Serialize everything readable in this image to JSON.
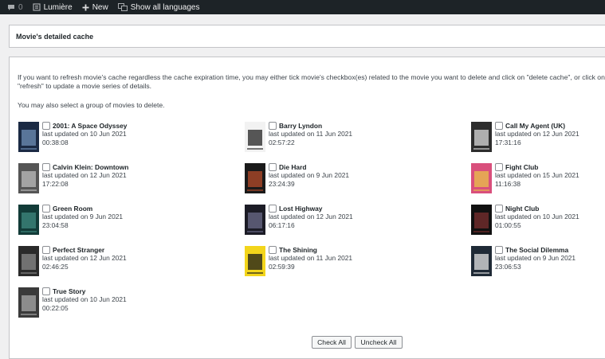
{
  "admin_bar": {
    "comments_count": "0",
    "site_name": "Lumière",
    "new_label": "New",
    "languages_label": "Show all languages"
  },
  "title_panel": {
    "title": "Movie's detailed cache"
  },
  "body": {
    "intro": "If you want to refresh movie's cache regardless the cache expiration time, you may either tick movie's checkbox(es) related to the movie you want to delete and click on \"delete cache\", or click on \"refresh\" to update a movie series of details.",
    "group_note": "You may also select a group of movies to delete."
  },
  "movies": [
    {
      "title": "2001: A Space Odyssey",
      "updated": "last updated on 10 Jun 2021",
      "time": "00:38:08",
      "poster_colors": [
        "#1b2a44",
        "#6f8fb5"
      ]
    },
    {
      "title": "Barry Lyndon",
      "updated": "last updated on 11 Jun 2021",
      "time": "02:57:22",
      "poster_colors": [
        "#f2f2f2",
        "#222222"
      ]
    },
    {
      "title": "Call My Agent (UK)",
      "updated": "last updated on 12 Jun 2021",
      "time": "17:31:16",
      "poster_colors": [
        "#2d2d2d",
        "#d9d9d9"
      ]
    },
    {
      "title": "Calvin Klein: Downtown",
      "updated": "last updated on 12 Jun 2021",
      "time": "17:22:08",
      "poster_colors": [
        "#555555",
        "#bdbdbd"
      ]
    },
    {
      "title": "Die Hard",
      "updated": "last updated on 9 Jun 2021",
      "time": "23:24:39",
      "poster_colors": [
        "#1a1a1a",
        "#b44b2a"
      ]
    },
    {
      "title": "Fight Club",
      "updated": "last updated on 15 Jun 2021",
      "time": "11:16:38",
      "poster_colors": [
        "#d94f7c",
        "#e8c04a"
      ]
    },
    {
      "title": "Green Room",
      "updated": "last updated on 9 Jun 2021",
      "time": "23:04:58",
      "poster_colors": [
        "#123b38",
        "#3f8a7f"
      ]
    },
    {
      "title": "Lost Highway",
      "updated": "last updated on 12 Jun 2021",
      "time": "06:17:16",
      "poster_colors": [
        "#1c1c26",
        "#6b6b8a"
      ]
    },
    {
      "title": "Night Club",
      "updated": "last updated on 10 Jun 2021",
      "time": "01:00:55",
      "poster_colors": [
        "#111111",
        "#7a2f2f"
      ]
    },
    {
      "title": "Perfect Stranger",
      "updated": "last updated on 12 Jun 2021",
      "time": "02:46:25",
      "poster_colors": [
        "#2a2a2a",
        "#8a8a8a"
      ]
    },
    {
      "title": "The Shining",
      "updated": "last updated on 11 Jun 2021",
      "time": "02:59:39",
      "poster_colors": [
        "#f3d51b",
        "#1a1a1a"
      ]
    },
    {
      "title": "The Social Dilemma",
      "updated": "last updated on 9 Jun 2021",
      "time": "23:06:53",
      "poster_colors": [
        "#1f2a36",
        "#e3e3e3"
      ]
    },
    {
      "title": "True Story",
      "updated": "last updated on 10 Jun 2021",
      "time": "00:22:05",
      "poster_colors": [
        "#3a3a3a",
        "#a8a8a8"
      ]
    }
  ],
  "buttons": {
    "check_all": "Check All",
    "uncheck_all": "Uncheck All"
  }
}
